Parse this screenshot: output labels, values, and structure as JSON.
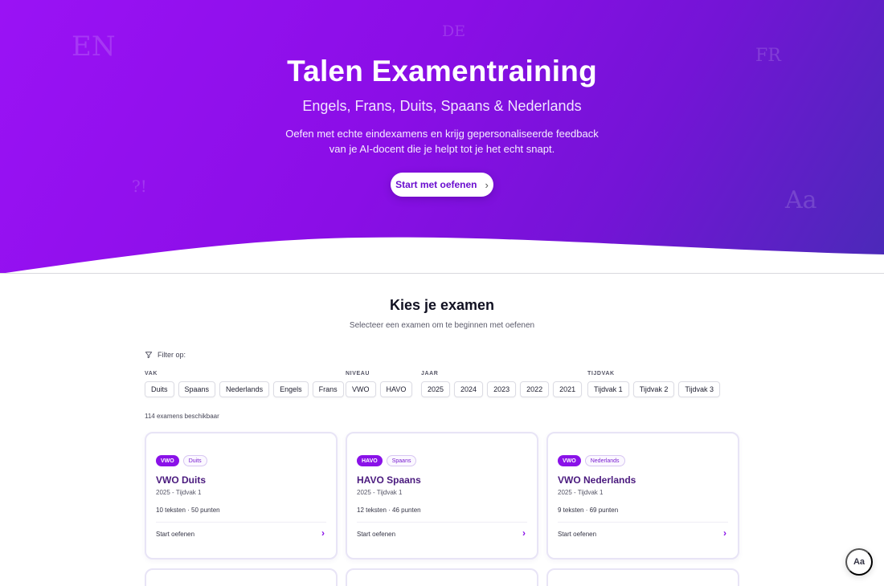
{
  "hero": {
    "title": "Talen Examentraining",
    "subtitle": "Engels, Frans, Duits, Spaans & Nederlands",
    "description": "Oefen met echte eindexamens en krijg gepersonaliseerde feedback van je AI-docent die je helpt tot je het echt snapt.",
    "cta_label": "Start met oefenen",
    "decorations": [
      "EN",
      "DE",
      "FR",
      "?!",
      "Aa"
    ]
  },
  "section": {
    "title": "Kies je examen",
    "subtitle": "Selecteer een examen om te beginnen met oefenen"
  },
  "filters": {
    "label": "Filter op:",
    "groups": [
      {
        "label": "VAK",
        "options": [
          "Duits",
          "Spaans",
          "Nederlands",
          "Engels",
          "Frans"
        ]
      },
      {
        "label": "NIVEAU",
        "options": [
          "VWO",
          "HAVO"
        ]
      },
      {
        "label": "JAAR",
        "options": [
          "2025",
          "2024",
          "2023",
          "2022",
          "2021"
        ]
      },
      {
        "label": "TIJDVAK",
        "options": [
          "Tijdvak 1",
          "Tijdvak 2",
          "Tijdvak 3"
        ]
      }
    ]
  },
  "results_count": "114 examens beschikbaar",
  "cards": [
    {
      "level": "VWO",
      "language": "Duits",
      "title": "VWO Duits",
      "meta": "2025 - Tijdvak 1",
      "stats": "10 teksten · 50 punten",
      "start_label": "Start oefenen"
    },
    {
      "level": "HAVO",
      "language": "Spaans",
      "title": "HAVO Spaans",
      "meta": "2025 - Tijdvak 1",
      "stats": "12 teksten · 46 punten",
      "start_label": "Start oefenen"
    },
    {
      "level": "VWO",
      "language": "Nederlands",
      "title": "VWO Nederlands",
      "meta": "2025 - Tijdvak 1",
      "stats": "9 teksten · 69 punten",
      "start_label": "Start oefenen"
    }
  ],
  "font_button_label": "Aa",
  "colors": {
    "hero_gradient_start": "#9a12f5",
    "hero_gradient_end": "#4a2ab8",
    "accent": "#8a12e8",
    "card_title": "#4a1a7e"
  }
}
